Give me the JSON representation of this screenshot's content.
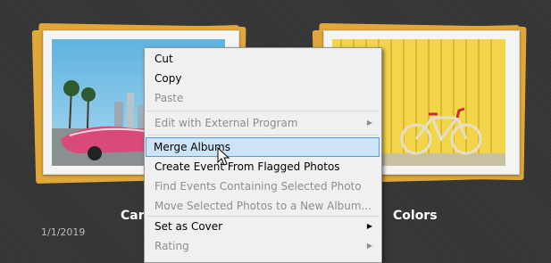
{
  "albums": [
    {
      "title": "Cars",
      "date": "1/1/2019"
    },
    {
      "title": "Colors"
    }
  ],
  "context_menu": {
    "items": [
      {
        "label": "Cut",
        "enabled": true
      },
      {
        "label": "Copy",
        "enabled": true
      },
      {
        "label": "Paste",
        "enabled": false
      },
      {
        "label": "Edit with External Program",
        "enabled": false,
        "submenu": true
      },
      {
        "label": "Merge Albums",
        "enabled": true,
        "highlighted": true
      },
      {
        "label": "Create Event From Flagged Photos",
        "enabled": true
      },
      {
        "label": "Find Events Containing Selected Photo",
        "enabled": false
      },
      {
        "label": "Move Selected Photos to a New Album...",
        "enabled": false
      },
      {
        "label": "Set as Cover",
        "enabled": true,
        "submenu": true
      },
      {
        "label": "Rating",
        "enabled": false,
        "submenu": true
      }
    ],
    "submenu_arrow": "▶"
  },
  "colors": {
    "frame": "#e0a83a",
    "highlight_bg": "#cce4f7",
    "highlight_border": "#5a9bd5"
  },
  "icons": {
    "cursor": "arrow-pointer-icon"
  }
}
